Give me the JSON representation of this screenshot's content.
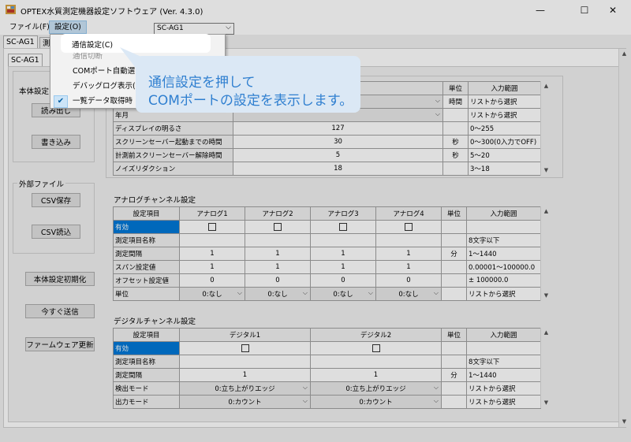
{
  "window": {
    "title": "OPTEX水質測定機器設定ソフトウェア (Ver. 4.3.0)",
    "minimize": "—",
    "maximize": "☐",
    "close": "✕"
  },
  "menu": {
    "file": "ファイル(F)",
    "settings": "設定(O)",
    "device_select": "SC-AG1"
  },
  "tabs": {
    "main_tab": "SC-AG1",
    "second_tab": "測",
    "sub_tab": "SC-AG1"
  },
  "left_panel": {
    "device_group": "本体設定",
    "read_button": "読み出し",
    "write_button": "書き込み",
    "external_group": "外部ファイル",
    "csv_save_button": "CSV保存",
    "csv_load_button": "CSV読込",
    "init_button": "本体設定初期化",
    "send_now_button": "今すぐ送信",
    "firmware_button": "ファームウェア更新"
  },
  "settings_menu": {
    "items": [
      "通信設定(C)",
      "通信切断",
      "COMポート自動選",
      "デバッグログ表示(",
      "一覧データ取得時"
    ],
    "checked_index": 4
  },
  "callout": {
    "line1": "通信設定を押して",
    "line2": "COMポートの設定を表示します。"
  },
  "device_table": {
    "header_unit": "単位",
    "header_range": "入力範囲",
    "rows": [
      {
        "label": "",
        "value": "",
        "unit": "時間",
        "range": "リストから選択"
      },
      {
        "label": "年月",
        "value": "",
        "unit": "",
        "range": "リストから選択"
      },
      {
        "label": "ディスプレイの明るさ",
        "value": "127",
        "unit": "",
        "range": "0〜255"
      },
      {
        "label": "スクリーンセーバー起動までの時間",
        "value": "30",
        "unit": "秒",
        "range": "0〜300(0入力でOFF)"
      },
      {
        "label": "計測前スクリーンセーバー解除時間",
        "value": "5",
        "unit": "秒",
        "range": "5〜20"
      },
      {
        "label": "ノイズリダクション",
        "value": "18",
        "unit": "",
        "range": "3〜18"
      }
    ]
  },
  "analog": {
    "title": "アナログチャンネル設定",
    "headers": [
      "設定項目",
      "アナログ1",
      "アナログ2",
      "アナログ3",
      "アナログ4",
      "単位",
      "入力範囲"
    ],
    "rows": [
      {
        "label": "有効",
        "values": [
          "",
          "",
          "",
          ""
        ],
        "unit": "",
        "range": ""
      },
      {
        "label": "測定項目名称",
        "values": [
          "",
          "",
          "",
          ""
        ],
        "unit": "",
        "range": "8文字以下"
      },
      {
        "label": "測定間隔",
        "values": [
          "1",
          "1",
          "1",
          "1"
        ],
        "unit": "分",
        "range": "1〜1440"
      },
      {
        "label": "スパン設定値",
        "values": [
          "1",
          "1",
          "1",
          "1"
        ],
        "unit": "",
        "range": "0.00001〜100000.0"
      },
      {
        "label": "オフセット設定値",
        "values": [
          "0",
          "0",
          "0",
          "0"
        ],
        "unit": "",
        "range": "± 100000.0"
      },
      {
        "label": "単位",
        "values": [
          "0:なし",
          "0:なし",
          "0:なし",
          "0:なし"
        ],
        "unit": "",
        "range": "リストから選択"
      }
    ]
  },
  "digital": {
    "title": "デジタルチャンネル設定",
    "headers": [
      "設定項目",
      "デジタル1",
      "デジタル2",
      "単位",
      "入力範囲"
    ],
    "rows": [
      {
        "label": "有効",
        "values": [
          "",
          ""
        ],
        "unit": "",
        "range": ""
      },
      {
        "label": "測定項目名称",
        "values": [
          "",
          ""
        ],
        "unit": "",
        "range": "8文字以下"
      },
      {
        "label": "測定間隔",
        "values": [
          "1",
          "1"
        ],
        "unit": "分",
        "range": "1〜1440"
      },
      {
        "label": "検出モード",
        "values": [
          "0:立ち上がりエッジ",
          "0:立ち上がりエッジ"
        ],
        "unit": "",
        "range": "リストから選択"
      },
      {
        "label": "出力モード",
        "values": [
          "0:カウント",
          "0:カウント"
        ],
        "unit": "",
        "range": "リストから選択"
      }
    ]
  }
}
